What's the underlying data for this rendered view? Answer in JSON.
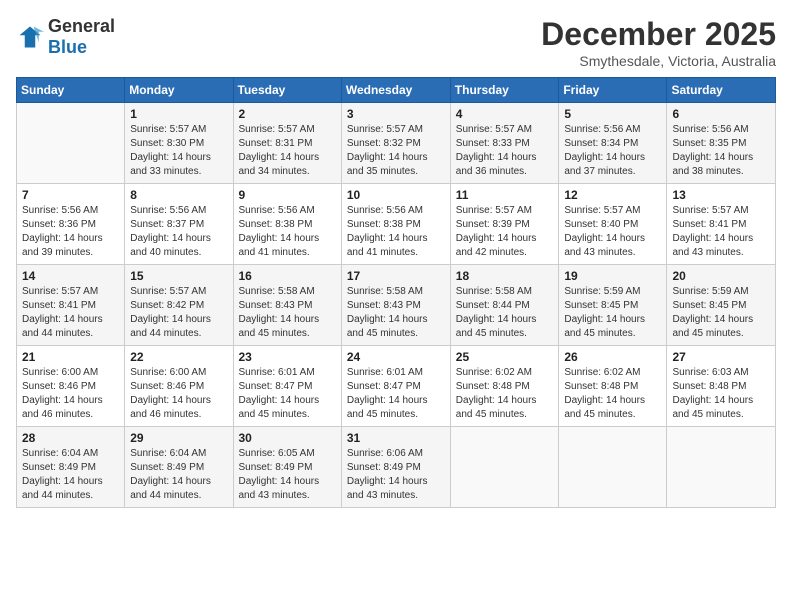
{
  "logo": {
    "text_general": "General",
    "text_blue": "Blue"
  },
  "title": "December 2025",
  "subtitle": "Smythesdale, Victoria, Australia",
  "days_header": [
    "Sunday",
    "Monday",
    "Tuesday",
    "Wednesday",
    "Thursday",
    "Friday",
    "Saturday"
  ],
  "weeks": [
    [
      {
        "day": "",
        "info": ""
      },
      {
        "day": "1",
        "info": "Sunrise: 5:57 AM\nSunset: 8:30 PM\nDaylight: 14 hours\nand 33 minutes."
      },
      {
        "day": "2",
        "info": "Sunrise: 5:57 AM\nSunset: 8:31 PM\nDaylight: 14 hours\nand 34 minutes."
      },
      {
        "day": "3",
        "info": "Sunrise: 5:57 AM\nSunset: 8:32 PM\nDaylight: 14 hours\nand 35 minutes."
      },
      {
        "day": "4",
        "info": "Sunrise: 5:57 AM\nSunset: 8:33 PM\nDaylight: 14 hours\nand 36 minutes."
      },
      {
        "day": "5",
        "info": "Sunrise: 5:56 AM\nSunset: 8:34 PM\nDaylight: 14 hours\nand 37 minutes."
      },
      {
        "day": "6",
        "info": "Sunrise: 5:56 AM\nSunset: 8:35 PM\nDaylight: 14 hours\nand 38 minutes."
      }
    ],
    [
      {
        "day": "7",
        "info": "Sunrise: 5:56 AM\nSunset: 8:36 PM\nDaylight: 14 hours\nand 39 minutes."
      },
      {
        "day": "8",
        "info": "Sunrise: 5:56 AM\nSunset: 8:37 PM\nDaylight: 14 hours\nand 40 minutes."
      },
      {
        "day": "9",
        "info": "Sunrise: 5:56 AM\nSunset: 8:38 PM\nDaylight: 14 hours\nand 41 minutes."
      },
      {
        "day": "10",
        "info": "Sunrise: 5:56 AM\nSunset: 8:38 PM\nDaylight: 14 hours\nand 41 minutes."
      },
      {
        "day": "11",
        "info": "Sunrise: 5:57 AM\nSunset: 8:39 PM\nDaylight: 14 hours\nand 42 minutes."
      },
      {
        "day": "12",
        "info": "Sunrise: 5:57 AM\nSunset: 8:40 PM\nDaylight: 14 hours\nand 43 minutes."
      },
      {
        "day": "13",
        "info": "Sunrise: 5:57 AM\nSunset: 8:41 PM\nDaylight: 14 hours\nand 43 minutes."
      }
    ],
    [
      {
        "day": "14",
        "info": "Sunrise: 5:57 AM\nSunset: 8:41 PM\nDaylight: 14 hours\nand 44 minutes."
      },
      {
        "day": "15",
        "info": "Sunrise: 5:57 AM\nSunset: 8:42 PM\nDaylight: 14 hours\nand 44 minutes."
      },
      {
        "day": "16",
        "info": "Sunrise: 5:58 AM\nSunset: 8:43 PM\nDaylight: 14 hours\nand 45 minutes."
      },
      {
        "day": "17",
        "info": "Sunrise: 5:58 AM\nSunset: 8:43 PM\nDaylight: 14 hours\nand 45 minutes."
      },
      {
        "day": "18",
        "info": "Sunrise: 5:58 AM\nSunset: 8:44 PM\nDaylight: 14 hours\nand 45 minutes."
      },
      {
        "day": "19",
        "info": "Sunrise: 5:59 AM\nSunset: 8:45 PM\nDaylight: 14 hours\nand 45 minutes."
      },
      {
        "day": "20",
        "info": "Sunrise: 5:59 AM\nSunset: 8:45 PM\nDaylight: 14 hours\nand 45 minutes."
      }
    ],
    [
      {
        "day": "21",
        "info": "Sunrise: 6:00 AM\nSunset: 8:46 PM\nDaylight: 14 hours\nand 46 minutes."
      },
      {
        "day": "22",
        "info": "Sunrise: 6:00 AM\nSunset: 8:46 PM\nDaylight: 14 hours\nand 46 minutes."
      },
      {
        "day": "23",
        "info": "Sunrise: 6:01 AM\nSunset: 8:47 PM\nDaylight: 14 hours\nand 45 minutes."
      },
      {
        "day": "24",
        "info": "Sunrise: 6:01 AM\nSunset: 8:47 PM\nDaylight: 14 hours\nand 45 minutes."
      },
      {
        "day": "25",
        "info": "Sunrise: 6:02 AM\nSunset: 8:48 PM\nDaylight: 14 hours\nand 45 minutes."
      },
      {
        "day": "26",
        "info": "Sunrise: 6:02 AM\nSunset: 8:48 PM\nDaylight: 14 hours\nand 45 minutes."
      },
      {
        "day": "27",
        "info": "Sunrise: 6:03 AM\nSunset: 8:48 PM\nDaylight: 14 hours\nand 45 minutes."
      }
    ],
    [
      {
        "day": "28",
        "info": "Sunrise: 6:04 AM\nSunset: 8:49 PM\nDaylight: 14 hours\nand 44 minutes."
      },
      {
        "day": "29",
        "info": "Sunrise: 6:04 AM\nSunset: 8:49 PM\nDaylight: 14 hours\nand 44 minutes."
      },
      {
        "day": "30",
        "info": "Sunrise: 6:05 AM\nSunset: 8:49 PM\nDaylight: 14 hours\nand 43 minutes."
      },
      {
        "day": "31",
        "info": "Sunrise: 6:06 AM\nSunset: 8:49 PM\nDaylight: 14 hours\nand 43 minutes."
      },
      {
        "day": "",
        "info": ""
      },
      {
        "day": "",
        "info": ""
      },
      {
        "day": "",
        "info": ""
      }
    ]
  ]
}
